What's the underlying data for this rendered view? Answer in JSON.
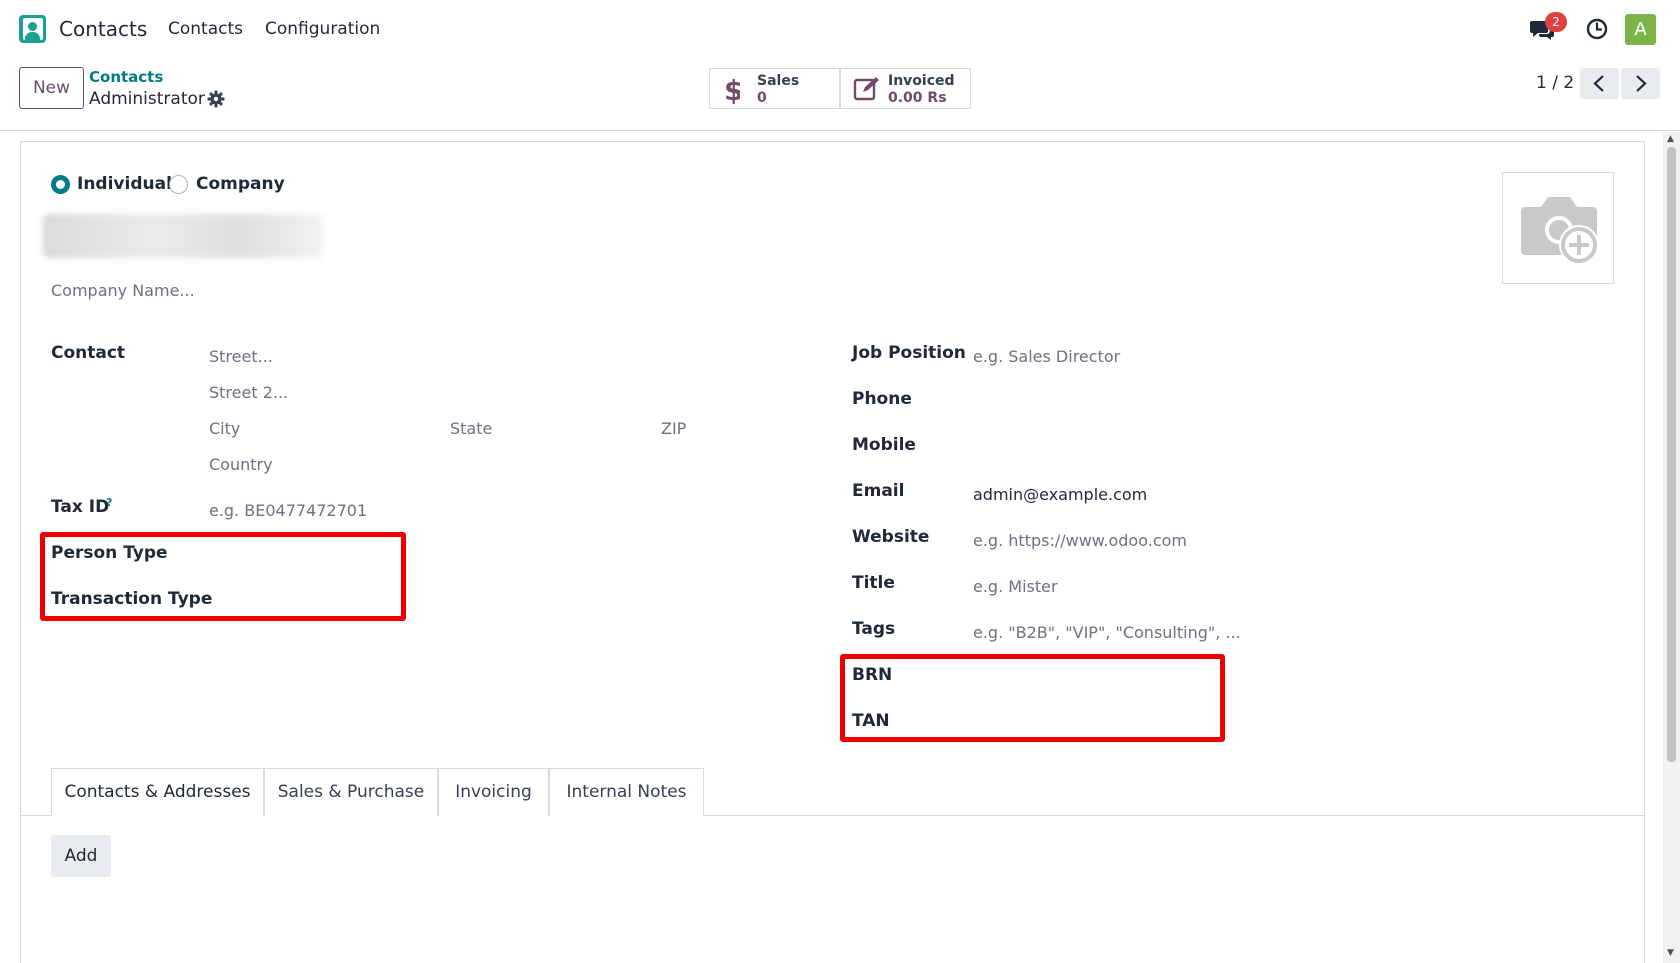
{
  "topbar": {
    "app_name": "Contacts",
    "menu": [
      "Contacts",
      "Configuration"
    ],
    "notification_count": "2",
    "avatar_letter": "A"
  },
  "control": {
    "new_label": "New",
    "breadcrumb_parent": "Contacts",
    "breadcrumb_current": "Administrator",
    "stats": [
      {
        "label": "Sales",
        "value": "0",
        "icon": "dollar-icon"
      },
      {
        "label": "Invoiced",
        "value": "0.00 Rs",
        "icon": "invoice-edit-icon"
      }
    ],
    "pager": "1 / 2"
  },
  "form": {
    "type_options": [
      "Individual",
      "Company"
    ],
    "selected_type": "Individual",
    "company_placeholder": "Company Name...",
    "left_fields": {
      "contact_label": "Contact",
      "street_ph": "Street...",
      "street2_ph": "Street 2...",
      "city_ph": "City",
      "state_ph": "State",
      "zip_ph": "ZIP",
      "country_ph": "Country",
      "taxid_label": "Tax ID",
      "taxid_help": "?",
      "taxid_ph": "e.g. BE0477472701",
      "person_type_label": "Person Type",
      "transaction_type_label": "Transaction Type"
    },
    "right_fields": {
      "job_label": "Job Position",
      "job_ph": "e.g. Sales Director",
      "phone_label": "Phone",
      "mobile_label": "Mobile",
      "email_label": "Email",
      "email_value": "admin@example.com",
      "website_label": "Website",
      "website_ph": "e.g. https://www.odoo.com",
      "title_label": "Title",
      "title_ph": "e.g. Mister",
      "tags_label": "Tags",
      "tags_ph": "e.g. \"B2B\", \"VIP\", \"Consulting\", ...",
      "brn_label": "BRN",
      "tan_label": "TAN"
    },
    "tabs": [
      "Contacts & Addresses",
      "Sales & Purchase",
      "Invoicing",
      "Internal Notes"
    ],
    "active_tab": "Contacts & Addresses",
    "add_label": "Add"
  },
  "colors": {
    "accent": "#017e84",
    "brand": "#714B67",
    "highlight": "#ee0000"
  }
}
